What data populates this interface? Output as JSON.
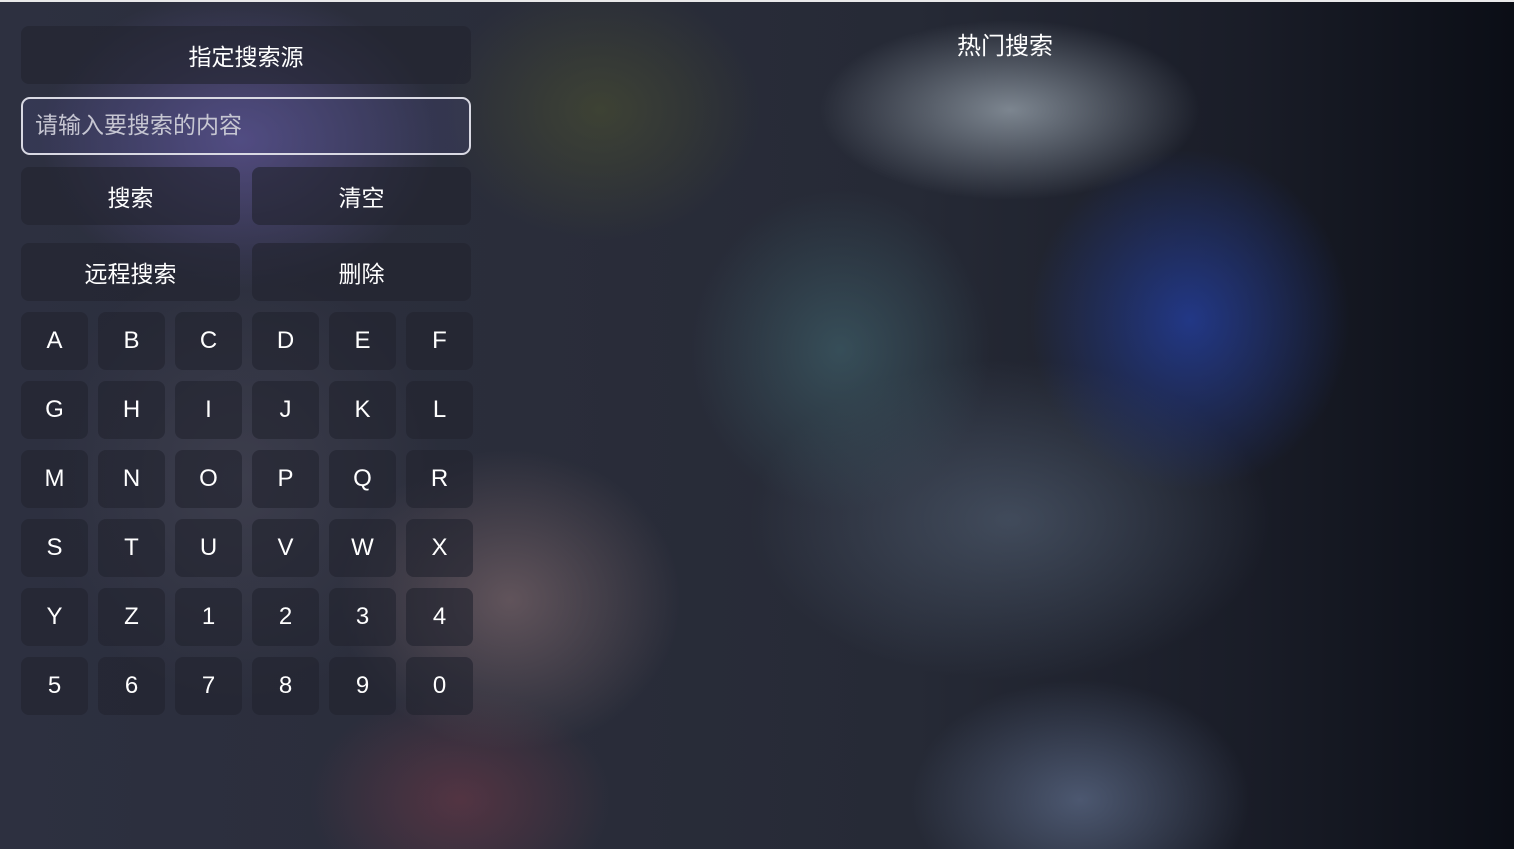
{
  "search_panel": {
    "source_button": "指定搜索源",
    "input_value": "",
    "input_placeholder": "请输入要搜索的内容",
    "search_button": "搜索",
    "clear_button": "清空",
    "remote_search_button": "远程搜索",
    "delete_button": "删除"
  },
  "keyboard": {
    "keys": [
      "A",
      "B",
      "C",
      "D",
      "E",
      "F",
      "G",
      "H",
      "I",
      "J",
      "K",
      "L",
      "M",
      "N",
      "O",
      "P",
      "Q",
      "R",
      "S",
      "T",
      "U",
      "V",
      "W",
      "X",
      "Y",
      "Z",
      "1",
      "2",
      "3",
      "4",
      "5",
      "6",
      "7",
      "8",
      "9",
      "0"
    ]
  },
  "hot_search": {
    "title": "热门搜索"
  }
}
